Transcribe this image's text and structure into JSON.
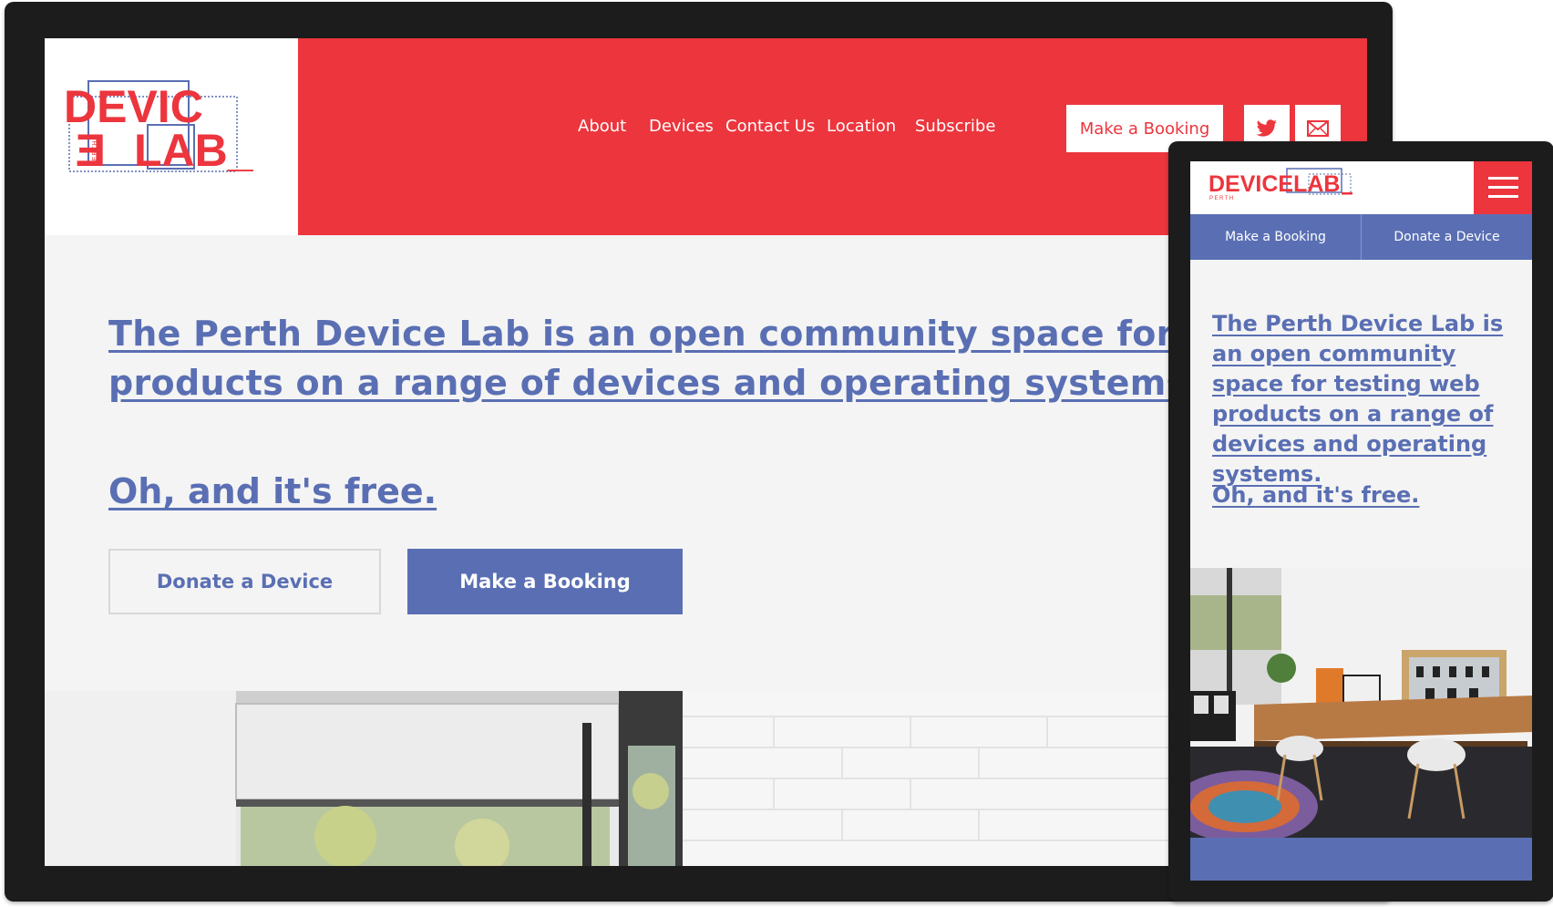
{
  "colors": {
    "brand_red": "#ec353d",
    "brand_blue": "#5a6fb3",
    "background": "#f4f4f4",
    "frame": "#1c1c1c"
  },
  "logo": {
    "line1": "DEVIC",
    "line2": "LAB_",
    "small": "PERTH",
    "mobile_text": "DEVICELAB",
    "mobile_small": "PERTH"
  },
  "desktop": {
    "nav": [
      {
        "label": "About"
      },
      {
        "label": "Devices"
      },
      {
        "label": "Contact Us"
      },
      {
        "label": "Location"
      },
      {
        "label": "Subscribe"
      }
    ],
    "booking_button": "Make a Booking",
    "twitter_icon": "twitter-bird-icon",
    "email_icon": "envelope-icon",
    "headline_line1": "The Perth Device Lab is an open community space for testi",
    "headline_line2": "products on a range of devices and operating systems.",
    "tagline": "Oh, and it's free.",
    "donate_button": "Donate a Device",
    "cta_button": "Make a Booking"
  },
  "mobile": {
    "menu_icon": "hamburger-menu-icon",
    "action_booking": "Make a Booking",
    "action_donate": "Donate a Device",
    "headline": "The Perth Device Lab is an open community space for testing web products on a range of devices and operating systems.",
    "tagline": "Oh, and it's free."
  }
}
